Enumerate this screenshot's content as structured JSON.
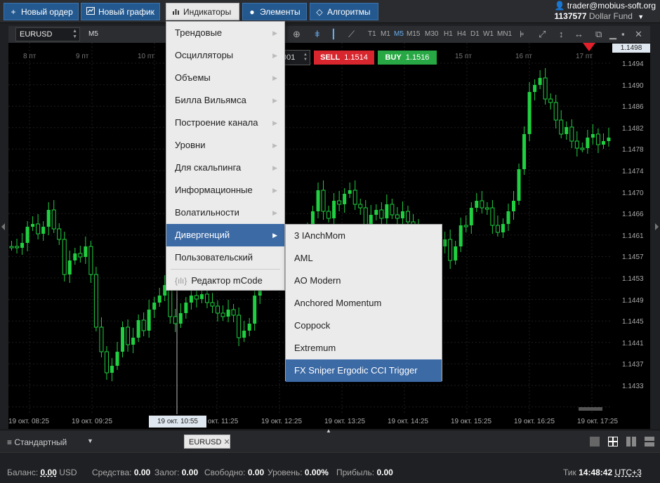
{
  "topbar": {
    "new_order": "Новый ордер",
    "new_chart": "Новый график",
    "indicators": "Индикаторы",
    "elements": "Элементы",
    "algorithms": "Алгоритмы",
    "user_email": "trader@mobius-soft.org",
    "account_id": "1137577",
    "account_name": "Dollar Fund"
  },
  "chart_toolbar": {
    "symbol": "EURUSD",
    "timeframe": "M5",
    "timeframes": [
      "T1",
      "M1",
      "M5",
      "M15",
      "M30",
      "H1",
      "H4",
      "D1",
      "W1",
      "MN1"
    ],
    "selected_timeframe": "M5"
  },
  "trade": {
    "lot_value": "001",
    "sell_label": "SELL",
    "sell_price": "1.1514",
    "buy_label": "BUY",
    "buy_price": "1.1516"
  },
  "price_axis": {
    "current_price": "1.1498",
    "ticks": [
      "1.1494",
      "1.1490",
      "1.1486",
      "1.1482",
      "1.1478",
      "1.1474",
      "1.1470",
      "1.1466",
      "1.1461",
      "1.1457",
      "1.1453",
      "1.1449",
      "1.1445",
      "1.1441",
      "1.1437",
      "1.1433"
    ]
  },
  "time_axis": {
    "labels": [
      "19 окт. 08:25",
      "19 окт. 09:25",
      "19 окт. 10:55",
      "19 окт. 11:25",
      "19 окт. 12:25",
      "19 окт. 13:25",
      "19 окт. 14:25",
      "19 окт. 15:25",
      "19 окт. 16:25",
      "19 окт. 17:25"
    ],
    "cursor_time": "19 окт. 10:55",
    "date_labels": [
      "8 пт",
      "9 пт",
      "10 пт",
      "15 пт",
      "16 пт",
      "17 пт"
    ]
  },
  "indicators_menu": {
    "items": [
      {
        "label": "Трендовые"
      },
      {
        "label": "Осцилляторы"
      },
      {
        "label": "Объемы"
      },
      {
        "label": "Билла Вильямса"
      },
      {
        "label": "Построение канала"
      },
      {
        "label": "Уровни"
      },
      {
        "label": "Для скальпинга"
      },
      {
        "label": "Информационные"
      },
      {
        "label": "Волатильности"
      },
      {
        "label": "Дивергенций"
      },
      {
        "label": "Пользовательский"
      }
    ],
    "editor": "Редактор mCode",
    "editor_icon_text": "{ılı}"
  },
  "divergence_submenu": {
    "items": [
      "3 IAnchMom",
      "AML",
      "AO Modern",
      "Anchored Momentum",
      "Coppock",
      "Extremum",
      "FX Sniper Ergodic CCI Trigger"
    ]
  },
  "tabbar": {
    "workspace": "Стандартный",
    "tab": "EURUSD",
    "close": "✕"
  },
  "status": {
    "balance_label": "Баланс:",
    "balance": "0.00",
    "currency": "USD",
    "funds_label": "Средства:",
    "funds": "0.00",
    "margin_label": "Залог:",
    "margin": "0.00",
    "free_label": "Свободно:",
    "free": "0.00",
    "level_label": "Уровень:",
    "level": "0.00%",
    "profit_label": "Прибыль:",
    "profit": "0.00",
    "tick_label": "Тик",
    "time": "14:48:42",
    "tz": "UTC+3"
  },
  "colors": {
    "bull": "#20d040",
    "bear": "#20d040",
    "menu_selected": "#3c6aa5",
    "sell": "#d7262e",
    "buy": "#27a844"
  }
}
